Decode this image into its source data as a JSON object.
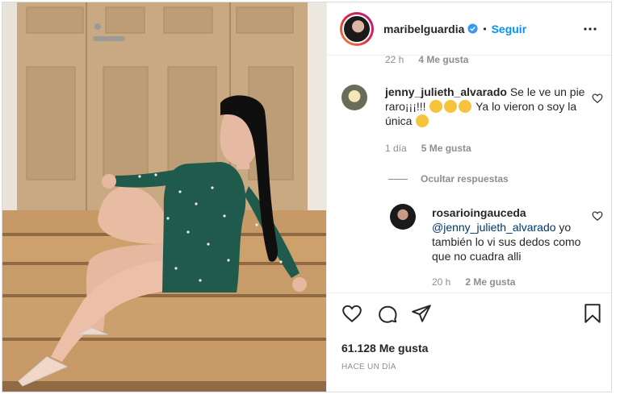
{
  "post": {
    "username": "maribelguardia",
    "separator": "•",
    "follow_label": "Seguir",
    "more_icon": "more-horizontal-icon",
    "verified_icon": "verified-badge-icon"
  },
  "comments": [
    {
      "id": "c0",
      "age": "22 h",
      "likes": "4 Me gusta"
    },
    {
      "id": "c1",
      "username": "jenny_julieth_alvarado",
      "text_a": "Se le ve un pie raro¡¡¡!!!",
      "text_b": "Ya lo vieron o soy la única",
      "age": "1 día",
      "likes": "5 Me gusta"
    },
    {
      "id": "hide",
      "label": "Ocultar respuestas"
    },
    {
      "id": "r1",
      "username": "rosarioingauceda",
      "mention": "@jenny_julieth_alvarado",
      "text": " yo también lo vi sus dedos como que no cuadra alli",
      "age": "20 h",
      "likes": "2 Me gusta"
    }
  ],
  "actions": {
    "likes_count": "61.128 Me gusta",
    "posted": "HACE UN DÍA"
  },
  "colors": {
    "accent": "#0095f6",
    "muted": "#8e8e8e",
    "dress": "#1f5a4c"
  }
}
